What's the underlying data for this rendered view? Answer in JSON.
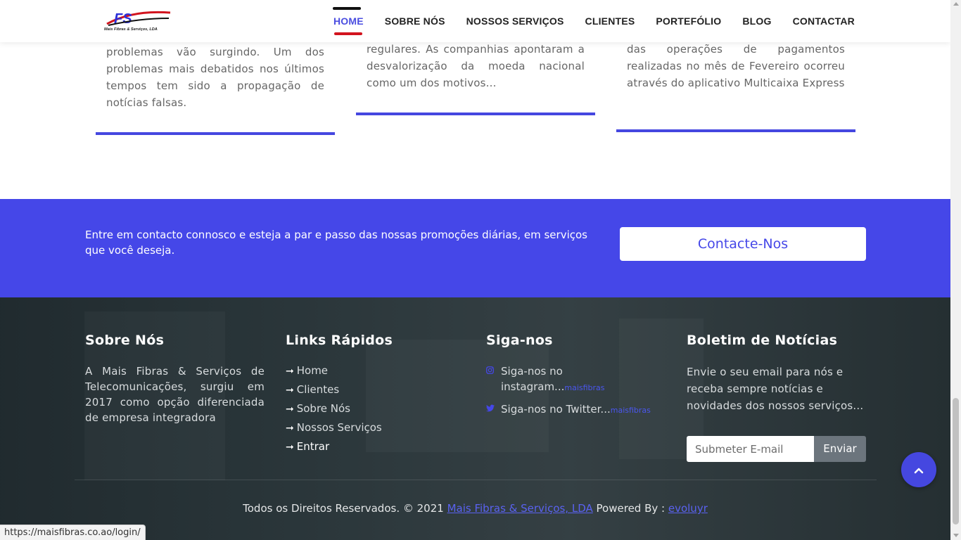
{
  "header": {
    "logo_text": "Mais Fibras & Serviços, LDA",
    "nav": [
      {
        "label": "HOME",
        "active": true
      },
      {
        "label": "SOBRE NÓS"
      },
      {
        "label": "NOSSOS SERVIÇOS"
      },
      {
        "label": "CLIENTES"
      },
      {
        "label": "PORTEFÓLIO"
      },
      {
        "label": "BLOG"
      },
      {
        "label": "CONTACTAR"
      }
    ]
  },
  "blog_cards": [
    {
      "excerpt": "problemas vão surgindo. Um dos problemas mais debatidos nos últimos tempos tem sido a propagação de notícias falsas."
    },
    {
      "excerpt": "regulares. As companhias apontaram a desvalorização da moeda nacional como um dos motivos..."
    },
    {
      "excerpt": "das operações de pagamentos realizadas no mês de Fevereiro ocorreu através do aplicativo Multicaixa Express"
    }
  ],
  "cta": {
    "text": "Entre em contacto connosco e esteja a par e passo das nossas promoções diárias, em serviços que você deseja.",
    "button": "Contacte-Nos",
    "background_color": "#4547e8"
  },
  "footer": {
    "about": {
      "title": "Sobre Nós",
      "text": "A Mais Fibras & Serviços de Telecomunicações, surgiu em 2017 como opção diferenciada de empresa integradora"
    },
    "quick_links": {
      "title": "Links Rápidos",
      "items": [
        "Home",
        "Clientes",
        "Sobre Nós",
        "Nossos Serviços",
        "Entrar"
      ]
    },
    "follow": {
      "title": "Siga-nos",
      "items": [
        {
          "icon": "instagram-icon",
          "text": "Siga-nos no instagram...",
          "handle": "maisfibras"
        },
        {
          "icon": "twitter-icon",
          "text": "Siga-nos no Twitter...",
          "handle": "maisfibras"
        }
      ]
    },
    "newsletter": {
      "title": "Boletim de Notícias",
      "text": "Envie o seu email para nós e receba sempre notícias e novidades dos nossos serviços...",
      "placeholder": "Submeter E-mail",
      "button": "Enviar"
    },
    "copyright": {
      "prefix": "Todos os Direitos Reservados. © 2021",
      "company": "Mais Fibras & Serviços, LDA",
      "powered_by": "Powered By :",
      "powered_link": "evoluyr"
    }
  },
  "status_bar": {
    "url": "https://maisfibras.co.ao/login/"
  }
}
